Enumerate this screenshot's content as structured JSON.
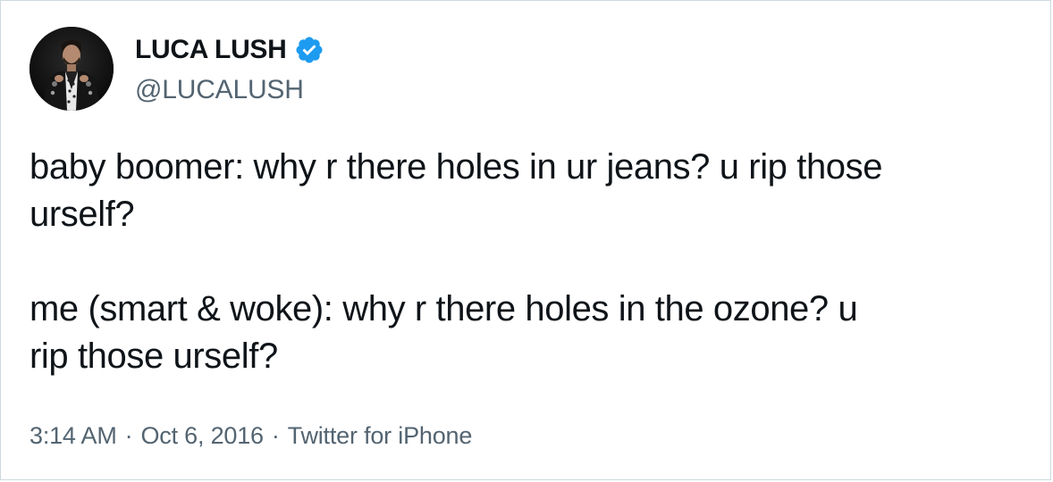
{
  "user": {
    "display_name": "LUCA LUSH",
    "handle": "@LUCALUSH",
    "verified": true
  },
  "tweet": {
    "lines_part1": [
      "baby boomer: why r there holes in ur jeans? u rip those",
      "urself?"
    ],
    "lines_part2": [
      "me (smart & woke): why r there holes in the ozone? u",
      "rip those urself?"
    ]
  },
  "meta": {
    "time": "3:14 AM",
    "separator": "·",
    "date": "Oct 6, 2016",
    "source": "Twitter for iPhone"
  },
  "colors": {
    "verified_blue": "#1d9bf0",
    "text_primary": "#0f1419",
    "text_secondary": "#536471",
    "border": "#cfd9de"
  },
  "icons": {
    "avatar": "profile-photo",
    "verified": "verified-badge-icon"
  }
}
